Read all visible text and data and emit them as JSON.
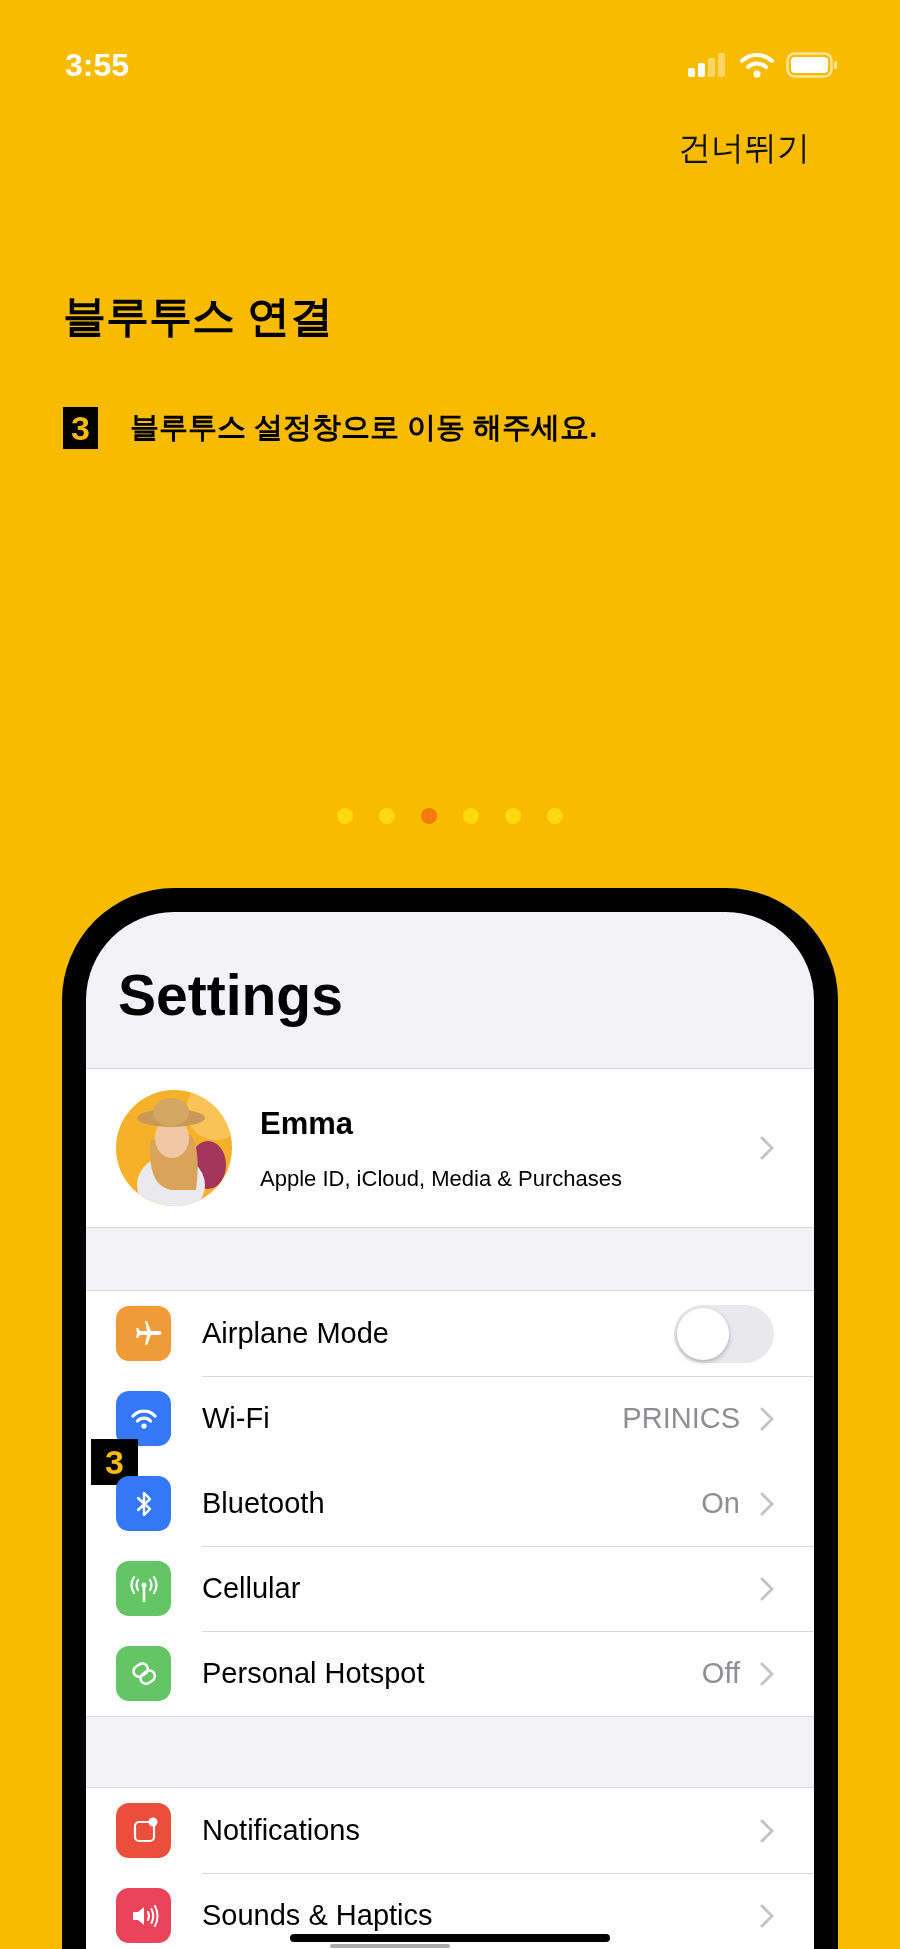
{
  "status_bar": {
    "time": "3:55"
  },
  "skip_button": "건너뛰기",
  "title": "블루투스 연결",
  "step": {
    "number": "3",
    "text": "블루투스 설정창으로 이동 해주세요."
  },
  "page_dots": [
    {
      "selected": false
    },
    {
      "selected": false
    },
    {
      "selected": true
    },
    {
      "selected": false
    },
    {
      "selected": false
    },
    {
      "selected": false
    }
  ],
  "phone": {
    "screen_title": "Settings",
    "profile": {
      "name": "Emma",
      "subtitle": "Apple ID, iCloud, Media & Purchases"
    },
    "groups": [
      [
        {
          "kind": "toggle",
          "label": "Airplane Mode",
          "color": "#f19a38",
          "on": false
        },
        {
          "kind": "link",
          "label": "Wi-Fi",
          "value": "PRINICS",
          "color": "#3478f6"
        },
        {
          "kind": "link",
          "label": "Bluetooth",
          "value": "On",
          "color": "#3478f6",
          "callout": "3"
        },
        {
          "kind": "link",
          "label": "Cellular",
          "color": "#65c466"
        },
        {
          "kind": "link",
          "label": "Personal Hotspot",
          "value": "Off",
          "color": "#65c466"
        }
      ],
      [
        {
          "kind": "link",
          "label": "Notifications",
          "color": "#eb4e3d"
        },
        {
          "kind": "link",
          "label": "Sounds & Haptics",
          "color": "#eb445a"
        }
      ]
    ]
  }
}
